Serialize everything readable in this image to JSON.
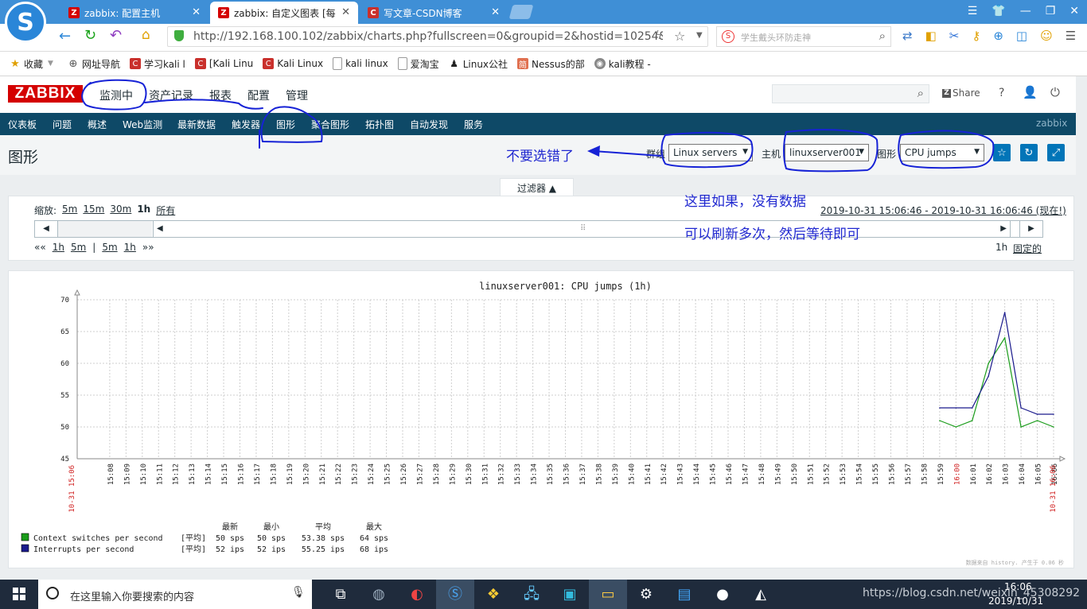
{
  "browser": {
    "tabs": [
      {
        "title": "zabbix: 配置主机",
        "active": false
      },
      {
        "title": "zabbix: 自定义图表 [每",
        "active": true
      },
      {
        "title": "写文章-CSDN博客",
        "active": false
      }
    ],
    "url": "http://192.168.100.102/zabbix/charts.php?fullscreen=0&groupid=2&hostid=10254&gr",
    "url_host": "192.168.100.102",
    "search_placeholder": "学生戴头环防走神",
    "bookmarks": [
      "收藏",
      "网址导航",
      "学习kali l",
      "[Kali Linu",
      "Kali Linux",
      "kali linux",
      "爱淘宝",
      "Linux公社",
      "Nessus的部",
      "kali教程 -"
    ]
  },
  "zabbix": {
    "logo": "ZABBIX",
    "main_menu": [
      "监测中",
      "资产记录",
      "报表",
      "配置",
      "管理"
    ],
    "share": "Share",
    "help": "?",
    "sub_menu": [
      "仪表板",
      "问题",
      "概述",
      "Web监测",
      "最新数据",
      "触发器",
      "图形",
      "聚合图形",
      "拓扑图",
      "自动发现",
      "服务"
    ],
    "sub_brand": "zabbix"
  },
  "page": {
    "title": "图形",
    "group_label": "群组",
    "group_value": "Linux servers",
    "host_label": "主机",
    "host_value": "linuxserver001",
    "graph_label": "图形",
    "graph_value": "CPU jumps"
  },
  "filter": {
    "tab_label": "过滤器 ▲",
    "zoom_label": "缩放:",
    "zoom_options": [
      "5m",
      "15m",
      "30m",
      "1h",
      "所有"
    ],
    "range_text": "2019-10-31 15:06:46 - 2019-10-31 16:06:46 (现在!)",
    "nav_left": [
      "««",
      "1h",
      "5m",
      "|",
      "5m",
      "1h",
      "»»"
    ],
    "period": "1h",
    "fixed": "固定的"
  },
  "annotations": {
    "arrow_note": "不要选错了",
    "note_line1": "这里如果，没有数据",
    "note_line2": "可以刷新多次，然后等待即可"
  },
  "chart_data": {
    "type": "line",
    "title": "linuxserver001: CPU jumps (1h)",
    "ylim": [
      45,
      70
    ],
    "y_ticks": [
      "70",
      "65",
      "60",
      "55",
      "50",
      "45"
    ],
    "x_ticks": [
      "15:08",
      "15:09",
      "15:10",
      "15:11",
      "15:12",
      "15:13",
      "15:14",
      "15:15",
      "15:16",
      "15:17",
      "15:18",
      "15:19",
      "15:20",
      "15:21",
      "15:22",
      "15:23",
      "15:24",
      "15:25",
      "15:26",
      "15:27",
      "15:28",
      "15:29",
      "15:30",
      "15:31",
      "15:32",
      "15:33",
      "15:34",
      "15:35",
      "15:36",
      "15:37",
      "15:38",
      "15:39",
      "15:40",
      "15:41",
      "15:42",
      "15:43",
      "15:44",
      "15:45",
      "15:46",
      "15:47",
      "15:48",
      "15:49",
      "15:50",
      "15:51",
      "15:52",
      "15:53",
      "15:54",
      "15:55",
      "15:56",
      "15:57",
      "15:58",
      "15:59",
      "16:00",
      "16:01",
      "16:02",
      "16:03",
      "16:04",
      "16:05",
      "16:06"
    ],
    "x_start_label": "10-31 15:06",
    "x_end_label": "10-31 16:06",
    "series": [
      {
        "name": "Context switches per second",
        "color": "#1a9c1a",
        "x": [
          "15:59",
          "16:00",
          "16:01",
          "16:02",
          "16:03",
          "16:04",
          "16:05",
          "16:06"
        ],
        "values": [
          51,
          50,
          51,
          60,
          64,
          50,
          51,
          50
        ]
      },
      {
        "name": "Interrupts per second",
        "color": "#1a1a8c",
        "x": [
          "15:59",
          "16:00",
          "16:01",
          "16:02",
          "16:03",
          "16:04",
          "16:05",
          "16:06"
        ],
        "values": [
          53,
          53,
          53,
          58,
          68,
          53,
          52,
          52
        ]
      }
    ],
    "legend": {
      "headers": [
        "最新",
        "最小",
        "平均",
        "最大"
      ],
      "rows": [
        {
          "name": "Context switches per second",
          "func": "[平均]",
          "last": "50 sps",
          "min": "50 sps",
          "avg": "53.38 sps",
          "max": "64 sps"
        },
        {
          "name": "Interrupts per second",
          "func": "[平均]",
          "last": "52 ips",
          "min": "52 ips",
          "avg": "55.25 ips",
          "max": "68 ips"
        }
      ]
    },
    "footer": "数据来自 history. 产生于 0.06 秒"
  },
  "taskbar": {
    "search_placeholder": "在这里输入你要搜索的内容",
    "time": "16:06",
    "date": "2019/10/31",
    "watermark": "https://blog.csdn.net/weixin_45308292"
  }
}
